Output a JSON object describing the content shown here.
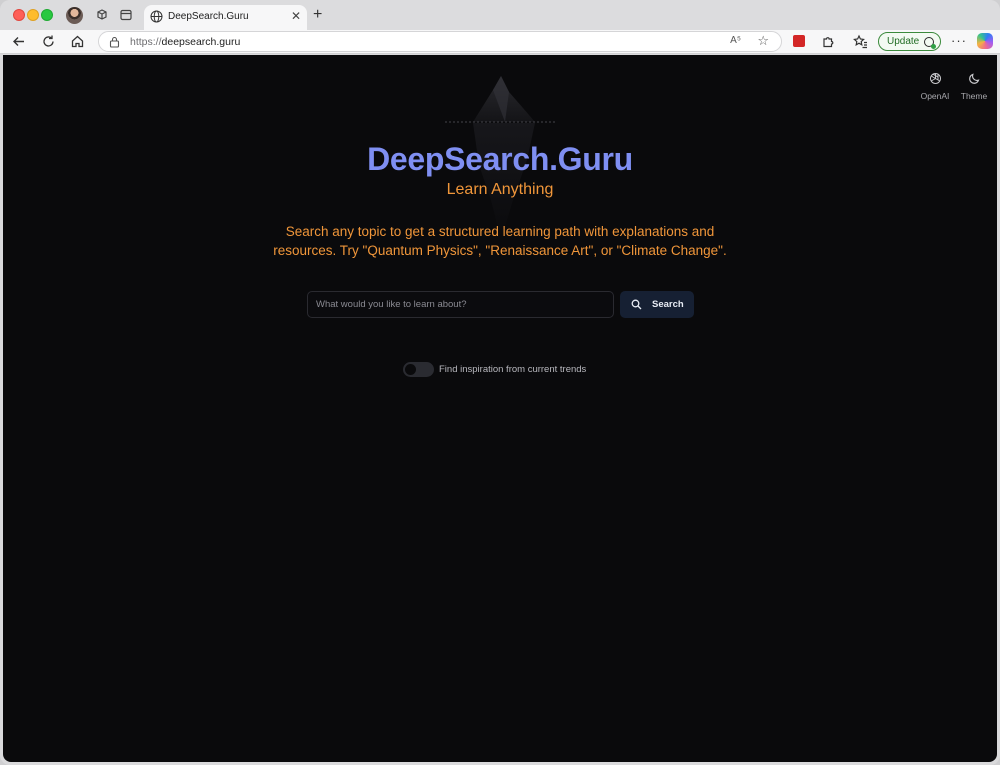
{
  "browser": {
    "tab_title": "DeepSearch.Guru",
    "url_scheme": "https://",
    "url_host": "deepsearch.guru",
    "update_label": "Update",
    "new_tab_symbol": "+",
    "close_symbol": "✕",
    "more_symbol": "···",
    "read_aloud_symbol": "A⁵"
  },
  "page": {
    "brand": "DeepSearch.Guru",
    "tagline": "Learn Anything",
    "description": "Search any topic to get a structured learning path with explanations and resources. Try \"Quantum Physics\", \"Renaissance Art\", or \"Climate Change\".",
    "search_placeholder": "What would you like to learn about?",
    "search_button": "Search",
    "trends_toggle_label": "Find inspiration from current trends",
    "trends_toggle_on": false,
    "top_actions": [
      {
        "label": "OpenAI",
        "icon": "openai-icon"
      },
      {
        "label": "Theme",
        "icon": "moon-icon"
      }
    ]
  },
  "colors": {
    "page_bg": "#0a0a0c",
    "brand": "#7f8ff2",
    "accent_orange": "#f0963a",
    "search_button_bg": "#162033"
  }
}
